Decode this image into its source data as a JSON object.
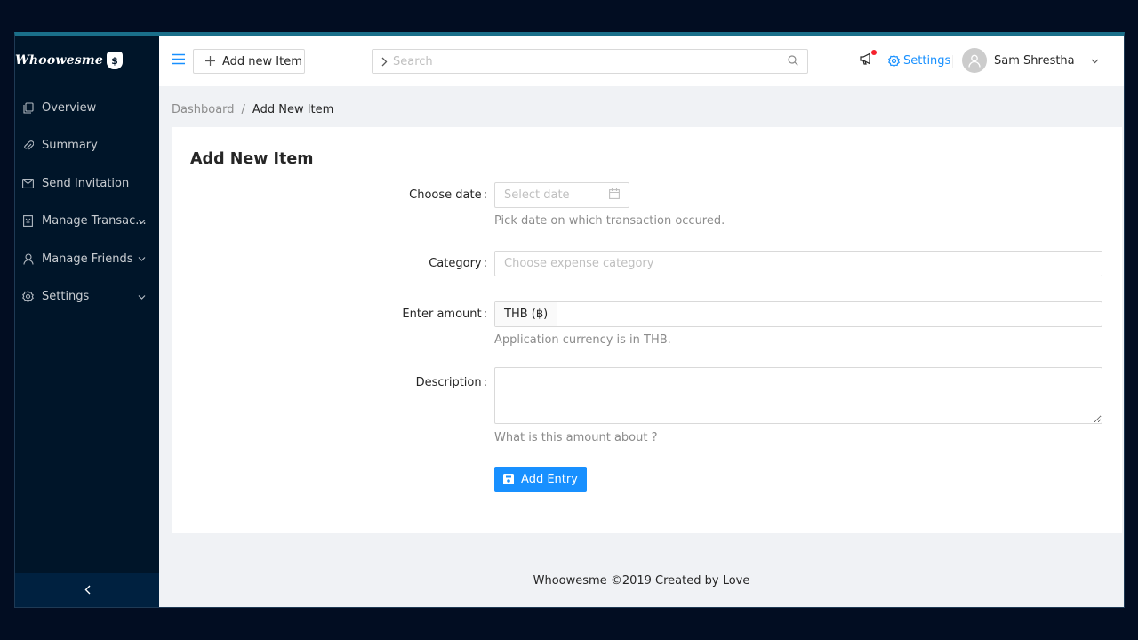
{
  "app": {
    "logo_text": "Whoowesme",
    "logo_badge": "$"
  },
  "sidebar": {
    "items": [
      {
        "label": "Overview",
        "icon": "copy-icon",
        "has_submenu": false
      },
      {
        "label": "Summary",
        "icon": "paperclip-icon",
        "has_submenu": false
      },
      {
        "label": "Send Invitation",
        "icon": "mail-icon",
        "has_submenu": false
      },
      {
        "label": "Manage Transac...",
        "icon": "transaction-icon",
        "has_submenu": true
      },
      {
        "label": "Manage Friends",
        "icon": "user-icon",
        "has_submenu": true
      },
      {
        "label": "Settings",
        "icon": "gear-icon",
        "has_submenu": true
      }
    ],
    "collapse_icon": "chevron-left-icon"
  },
  "header": {
    "menu_icon": "hamburger-icon",
    "add_button_label": "Add new Item",
    "search_placeholder": "Search",
    "notification_icon": "megaphone-icon",
    "settings_label": "Settings",
    "user_name": "Sam Shrestha"
  },
  "breadcrumb": {
    "root": "Dashboard",
    "separator": "/",
    "current": "Add New Item"
  },
  "form": {
    "title": "Add New Item",
    "date": {
      "label": "Choose date",
      "placeholder": "Select date",
      "help": "Pick date on which transaction occured."
    },
    "category": {
      "label": "Category",
      "placeholder": "Choose expense category"
    },
    "amount": {
      "label": "Enter amount",
      "addon": "THB (฿)",
      "value": "",
      "help": "Application currency is in THB."
    },
    "description": {
      "label": "Description",
      "value": "",
      "help": "What is this amount about ?"
    },
    "submit_label": "Add Entry"
  },
  "footer": {
    "text": "Whoowesme ©2019 Created by Love"
  },
  "colors": {
    "sidebar_bg": "#001529",
    "primary": "#1890ff",
    "page_bg": "#f0f2f5",
    "notification_dot": "#f5222d"
  }
}
